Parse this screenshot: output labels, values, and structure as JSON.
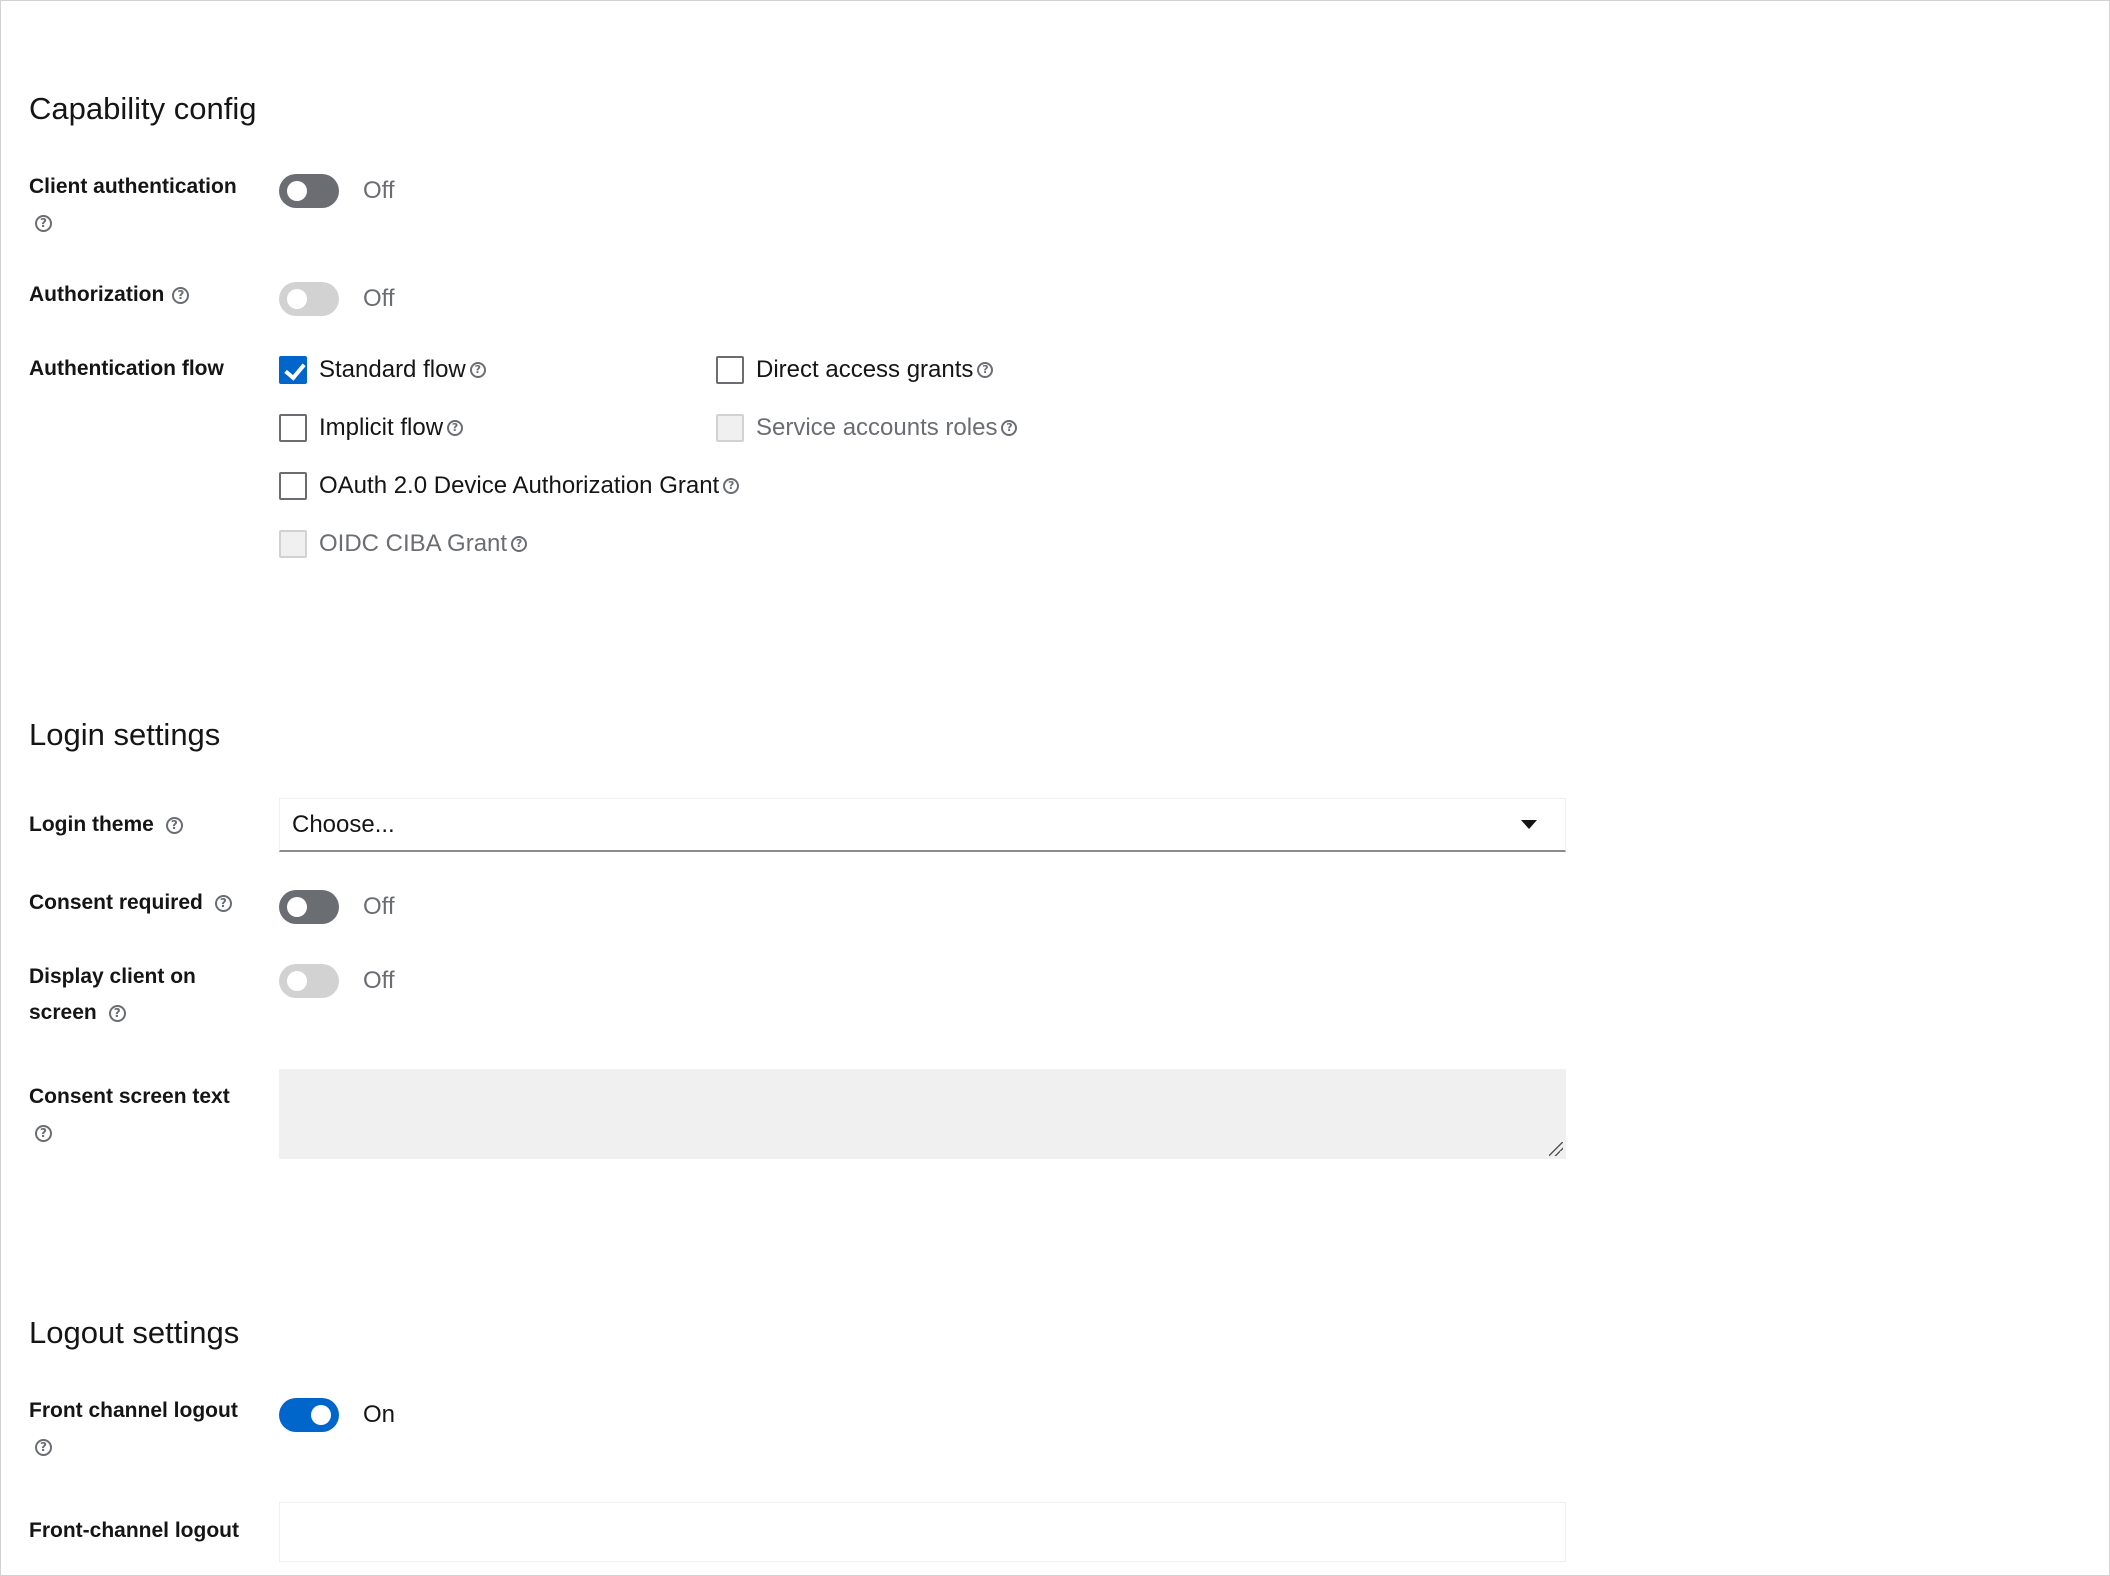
{
  "capability": {
    "title": "Capability config",
    "client_auth": {
      "label": "Client authentication",
      "state": "Off"
    },
    "authorization": {
      "label": "Authorization",
      "state": "Off"
    },
    "auth_flow": {
      "label": "Authentication flow",
      "options": {
        "standard": "Standard flow",
        "direct": "Direct access grants",
        "implicit": "Implicit flow",
        "service": "Service accounts roles",
        "device": "OAuth 2.0 Device Authorization Grant",
        "ciba": "OIDC CIBA Grant"
      }
    }
  },
  "login": {
    "title": "Login settings",
    "theme": {
      "label": "Login theme",
      "value": "Choose..."
    },
    "consent_required": {
      "label": "Consent required",
      "state": "Off"
    },
    "display_client": {
      "label_line1": "Display client on",
      "label_line2": "screen",
      "state": "Off"
    },
    "consent_text": {
      "label": "Consent screen text"
    }
  },
  "logout": {
    "title": "Logout settings",
    "front_channel": {
      "label": "Front channel logout",
      "state": "On"
    },
    "front_channel_url": {
      "label": "Front-channel logout"
    }
  },
  "colors": {
    "accent": "#0066cc",
    "muted": "#6a6e73",
    "disabled": "#d2d2d2"
  },
  "icons": {
    "help": "help-circle-icon",
    "dropdown": "caret-down-icon",
    "check": "checkmark-icon"
  }
}
